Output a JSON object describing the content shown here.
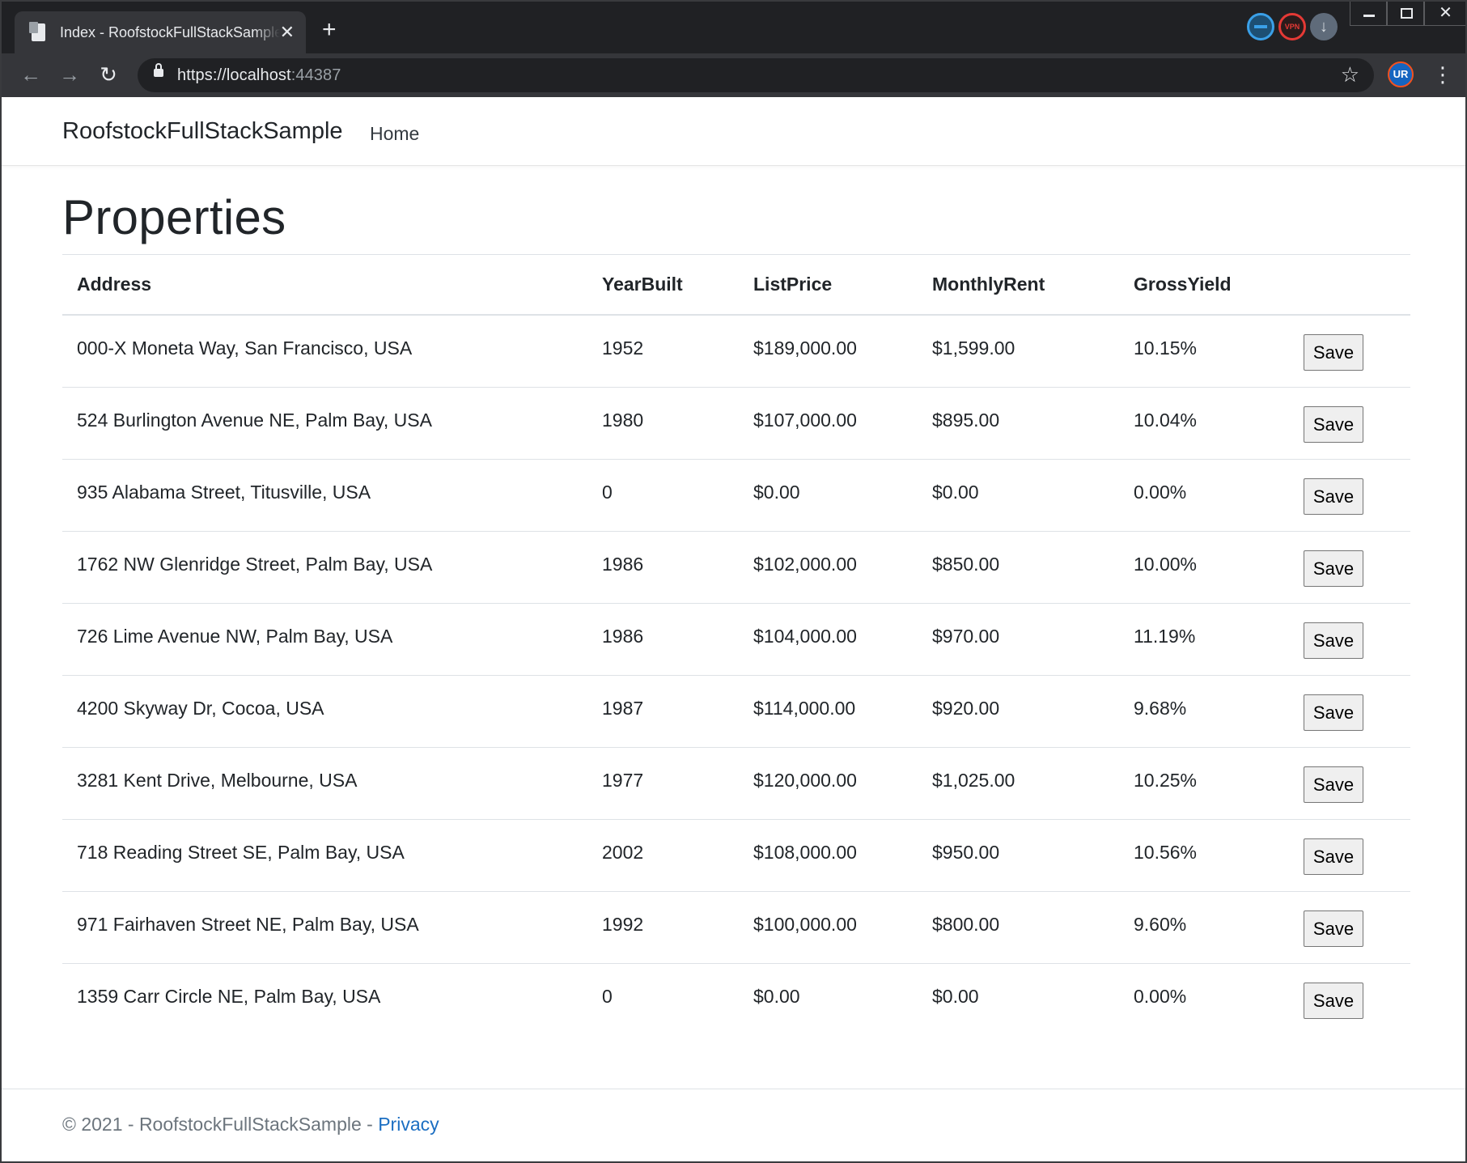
{
  "browser": {
    "tab_title": "Index - RoofstockFullStackSample",
    "tab_close": "✕",
    "new_tab": "+",
    "url_prefix": "https://",
    "url_host": "localhost",
    "url_port": ":44387",
    "ext_vpn_label": "VPN",
    "profile_label": "UR",
    "win_close": "✕"
  },
  "navbar": {
    "brand": "RoofstockFullStackSample",
    "links": [
      "Home"
    ]
  },
  "page": {
    "title": "Properties"
  },
  "table": {
    "columns": [
      "Address",
      "YearBuilt",
      "ListPrice",
      "MonthlyRent",
      "GrossYield",
      ""
    ],
    "save_label": "Save",
    "rows": [
      {
        "address": "000-X Moneta Way, San Francisco, USA",
        "year": "1952",
        "price": "$189,000.00",
        "rent": "$1,599.00",
        "yield": "10.15%"
      },
      {
        "address": "524 Burlington Avenue NE, Palm Bay, USA",
        "year": "1980",
        "price": "$107,000.00",
        "rent": "$895.00",
        "yield": "10.04%"
      },
      {
        "address": "935 Alabama Street, Titusville, USA",
        "year": "0",
        "price": "$0.00",
        "rent": "$0.00",
        "yield": "0.00%"
      },
      {
        "address": "1762 NW Glenridge Street, Palm Bay, USA",
        "year": "1986",
        "price": "$102,000.00",
        "rent": "$850.00",
        "yield": "10.00%"
      },
      {
        "address": "726 Lime Avenue NW, Palm Bay, USA",
        "year": "1986",
        "price": "$104,000.00",
        "rent": "$970.00",
        "yield": "11.19%"
      },
      {
        "address": "4200 Skyway Dr, Cocoa, USA",
        "year": "1987",
        "price": "$114,000.00",
        "rent": "$920.00",
        "yield": "9.68%"
      },
      {
        "address": "3281 Kent Drive, Melbourne, USA",
        "year": "1977",
        "price": "$120,000.00",
        "rent": "$1,025.00",
        "yield": "10.25%"
      },
      {
        "address": "718 Reading Street SE, Palm Bay, USA",
        "year": "2002",
        "price": "$108,000.00",
        "rent": "$950.00",
        "yield": "10.56%"
      },
      {
        "address": "971 Fairhaven Street NE, Palm Bay, USA",
        "year": "1992",
        "price": "$100,000.00",
        "rent": "$800.00",
        "yield": "9.60%"
      },
      {
        "address": "1359 Carr Circle NE, Palm Bay, USA",
        "year": "0",
        "price": "$0.00",
        "rent": "$0.00",
        "yield": "0.00%"
      }
    ]
  },
  "footer": {
    "copyright": "© 2021 - RoofstockFullStackSample - ",
    "privacy_link": "Privacy"
  }
}
